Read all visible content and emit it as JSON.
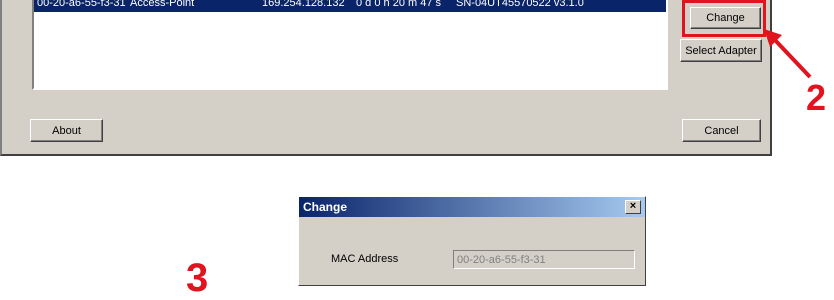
{
  "top_window": {
    "selected_row": {
      "mac": "00-20-a6-55-f3-31",
      "mode": "Access-Point",
      "ip": "169.254.128.132",
      "uptime": "0 d 0 h 20 m 47 s",
      "serial": "SN-04UT45570522 v3.1.0"
    },
    "buttons": {
      "change": "Change",
      "select_adapter": "Select Adapter",
      "about": "About",
      "cancel": "Cancel"
    }
  },
  "annotations": {
    "step2": "2",
    "step3": "3"
  },
  "change_dialog": {
    "title": "Change",
    "close_glyph": "×",
    "mac_label": "MAC Address",
    "mac_value": "00-20-a6-55-f3-31"
  },
  "colors": {
    "selection": "#0a246a",
    "annotation_red": "#e0141e",
    "window_face": "#d4d0c8"
  }
}
